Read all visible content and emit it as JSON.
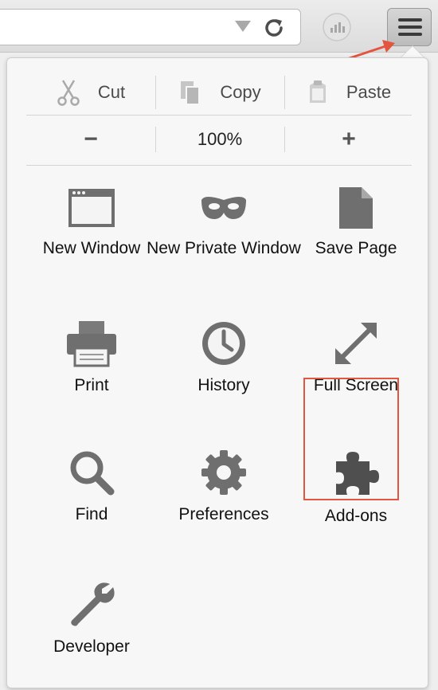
{
  "edit": {
    "cut": "Cut",
    "copy": "Copy",
    "paste": "Paste"
  },
  "zoom": {
    "minus": "−",
    "level": "100%",
    "plus": "+"
  },
  "items": [
    {
      "label": "New Window",
      "icon": "new-window-icon"
    },
    {
      "label": "New Private Window",
      "icon": "private-mask-icon"
    },
    {
      "label": "Save Page",
      "icon": "document-icon"
    },
    {
      "label": "Print",
      "icon": "printer-icon"
    },
    {
      "label": "History",
      "icon": "clock-icon"
    },
    {
      "label": "Full Screen",
      "icon": "fullscreen-arrows-icon"
    },
    {
      "label": "Find",
      "icon": "magnifier-icon"
    },
    {
      "label": "Preferences",
      "icon": "gear-icon"
    },
    {
      "label": "Add-ons",
      "icon": "puzzle-piece-icon"
    },
    {
      "label": "Developer",
      "icon": "wrench-icon"
    }
  ],
  "colors": {
    "highlight": "#e2553f",
    "icon": "#6f6f6f"
  }
}
